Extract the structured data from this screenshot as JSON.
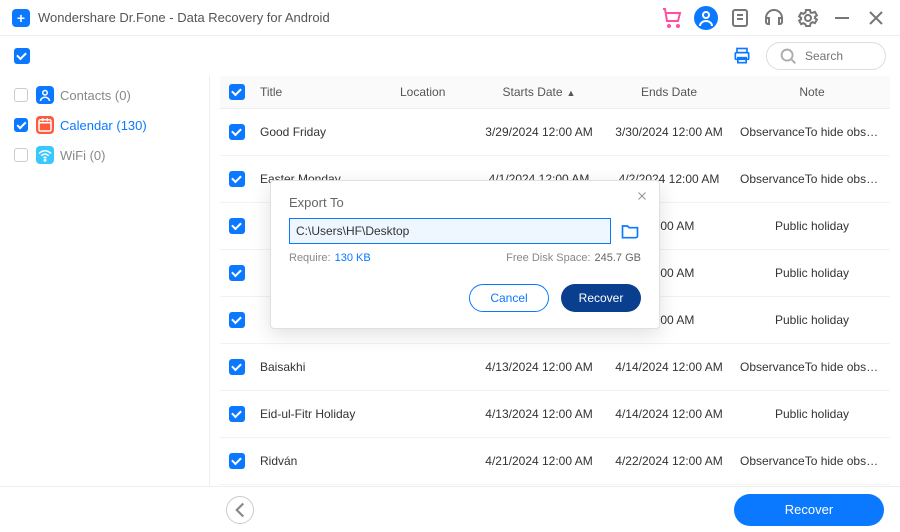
{
  "app": {
    "title": "Wondershare Dr.Fone - Data Recovery for Android"
  },
  "search": {
    "placeholder": "Search"
  },
  "sidebar": {
    "items": [
      {
        "label": "Contacts (0)",
        "checked": false,
        "icon_color": "#0b79ff"
      },
      {
        "label": "Calendar (130)",
        "checked": true,
        "icon_color": "#ff5a3c",
        "text_color": "#0b79ff"
      },
      {
        "label": "WiFi (0)",
        "checked": false,
        "icon_color": "#38c8ff"
      }
    ]
  },
  "table": {
    "headers": {
      "title": "Title",
      "location": "Location",
      "starts": "Starts Date",
      "ends": "Ends Date",
      "note": "Note"
    },
    "rows": [
      {
        "title": "Good Friday",
        "starts": "3/29/2024 12:00 AM",
        "ends": "3/30/2024 12:00 AM",
        "note": "ObservanceTo hide observances, go to..."
      },
      {
        "title": "Easter Monday",
        "starts": "4/1/2024 12:00 AM",
        "ends": "4/2/2024 12:00 AM",
        "note": "ObservanceTo hide observances, go to..."
      },
      {
        "title": "",
        "starts": "",
        "ends": "12:00 AM",
        "note": "Public holiday"
      },
      {
        "title": "",
        "starts": "",
        "ends": "12:00 AM",
        "note": "Public holiday"
      },
      {
        "title": "",
        "starts": "",
        "ends": "12:00 AM",
        "note": "Public holiday"
      },
      {
        "title": "Baisakhi",
        "starts": "4/13/2024 12:00 AM",
        "ends": "4/14/2024 12:00 AM",
        "note": "ObservanceTo hide observances, go to..."
      },
      {
        "title": "Eid-ul-Fitr Holiday",
        "starts": "4/13/2024 12:00 AM",
        "ends": "4/14/2024 12:00 AM",
        "note": "Public holiday"
      },
      {
        "title": "Ridván",
        "starts": "4/21/2024 12:00 AM",
        "ends": "4/22/2024 12:00 AM",
        "note": "ObservanceTo hide observances, go to..."
      }
    ]
  },
  "modal": {
    "title": "Export To",
    "path": "C:\\Users\\HF\\Desktop",
    "require_label": "Require:",
    "require_value": "130 KB",
    "free_label": "Free Disk Space:",
    "free_value": "245.7 GB",
    "cancel": "Cancel",
    "recover": "Recover"
  },
  "footer": {
    "recover": "Recover"
  }
}
